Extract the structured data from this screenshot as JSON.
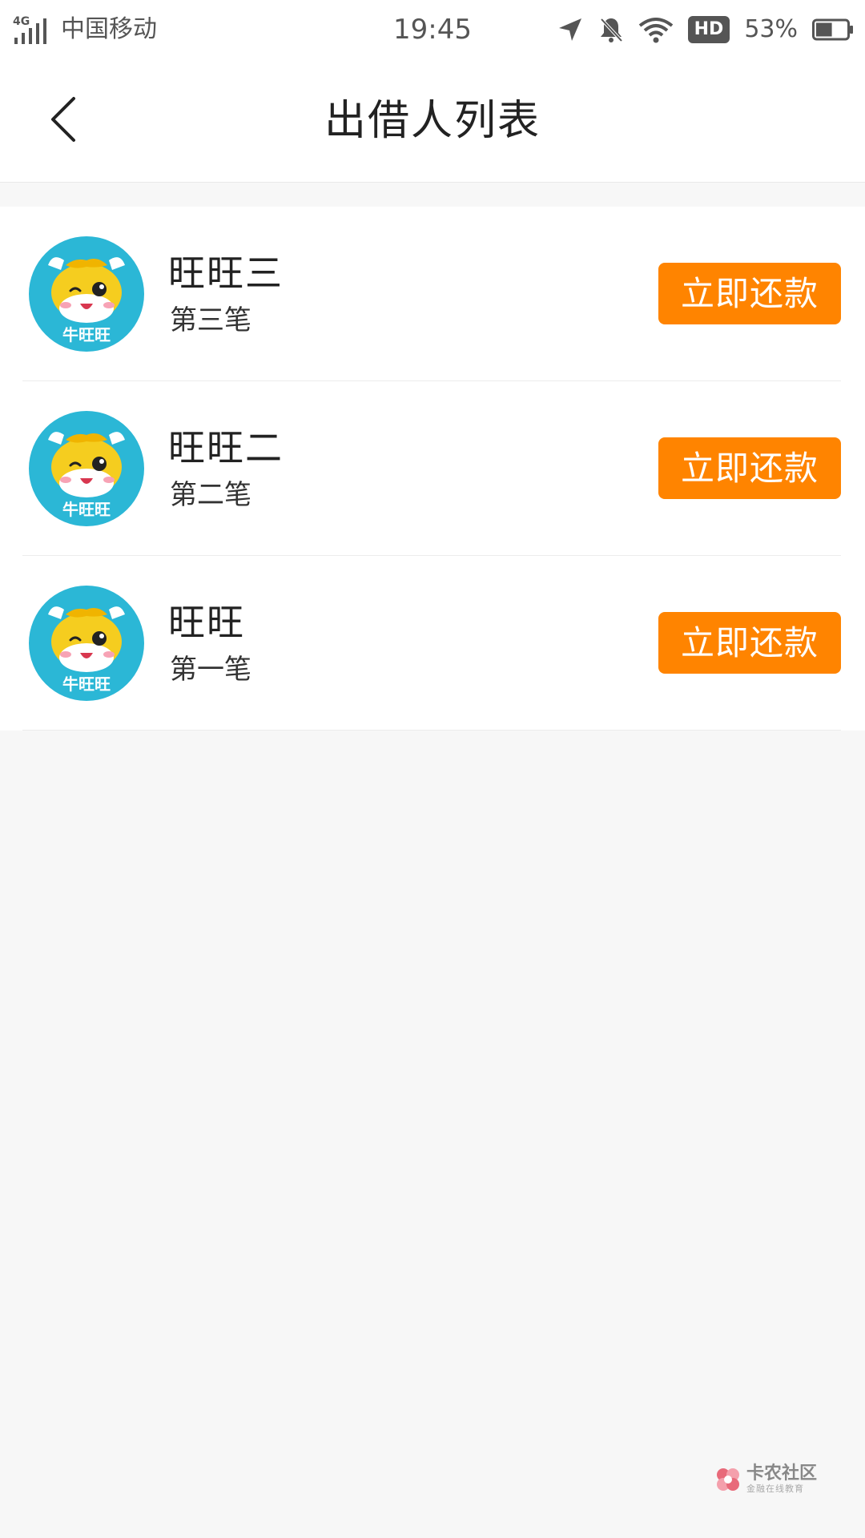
{
  "status_bar": {
    "network": "4G",
    "carrier": "中国移动",
    "time": "19:45",
    "hd": "HD",
    "battery": "53%",
    "battery_level": 0.53,
    "icons": [
      "signal-icon",
      "location-icon",
      "bell-muted-icon",
      "wifi-icon",
      "hd-icon",
      "battery-icon"
    ]
  },
  "header": {
    "title": "出借人列表",
    "back_icon": "chevron-left-icon"
  },
  "lenders": [
    {
      "name": "旺旺三",
      "loan": "第三笔",
      "action": "立即还款",
      "avatar_label": "牛旺旺"
    },
    {
      "name": "旺旺二",
      "loan": "第二笔",
      "action": "立即还款",
      "avatar_label": "牛旺旺"
    },
    {
      "name": "旺旺",
      "loan": "第一笔",
      "action": "立即还款",
      "avatar_label": "牛旺旺"
    }
  ],
  "watermark": {
    "title": "卡农社区",
    "subtitle": "金融在线教育"
  },
  "colors": {
    "accent": "#ff8400",
    "avatar_bg": "#2bb7d6",
    "page_bg": "#f7f7f7"
  }
}
